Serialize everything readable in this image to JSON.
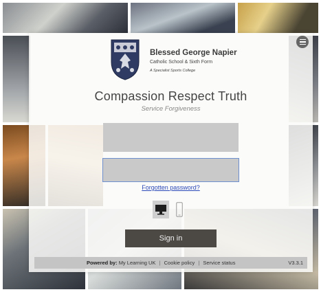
{
  "school": {
    "name": "Blessed George Napier",
    "subtitle": "Catholic School & Sixth Form",
    "tagline": "A Specialist Sports College"
  },
  "motto": {
    "main": "Compassion Respect Truth",
    "sub": "Service Forgiveness"
  },
  "login": {
    "username_value": "",
    "password_value": "",
    "forgot_label": "Forgotten password?",
    "signin_label": "Sign in"
  },
  "devices": {
    "selected": "desktop",
    "desktop_icon": "desktop-monitor-icon",
    "mobile_icon": "mobile-phone-icon"
  },
  "footer": {
    "powered_by_label": "Powered by:",
    "provider_link": "My Learning UK",
    "cookie_link": "Cookie policy",
    "status_link": "Service status",
    "separator": "|",
    "version": "V3.3.1"
  },
  "colors": {
    "signin_button": "#4c4844",
    "link": "#2b48b8",
    "field": "#c9c9c9",
    "footer_bar": "#c4c4c4"
  }
}
